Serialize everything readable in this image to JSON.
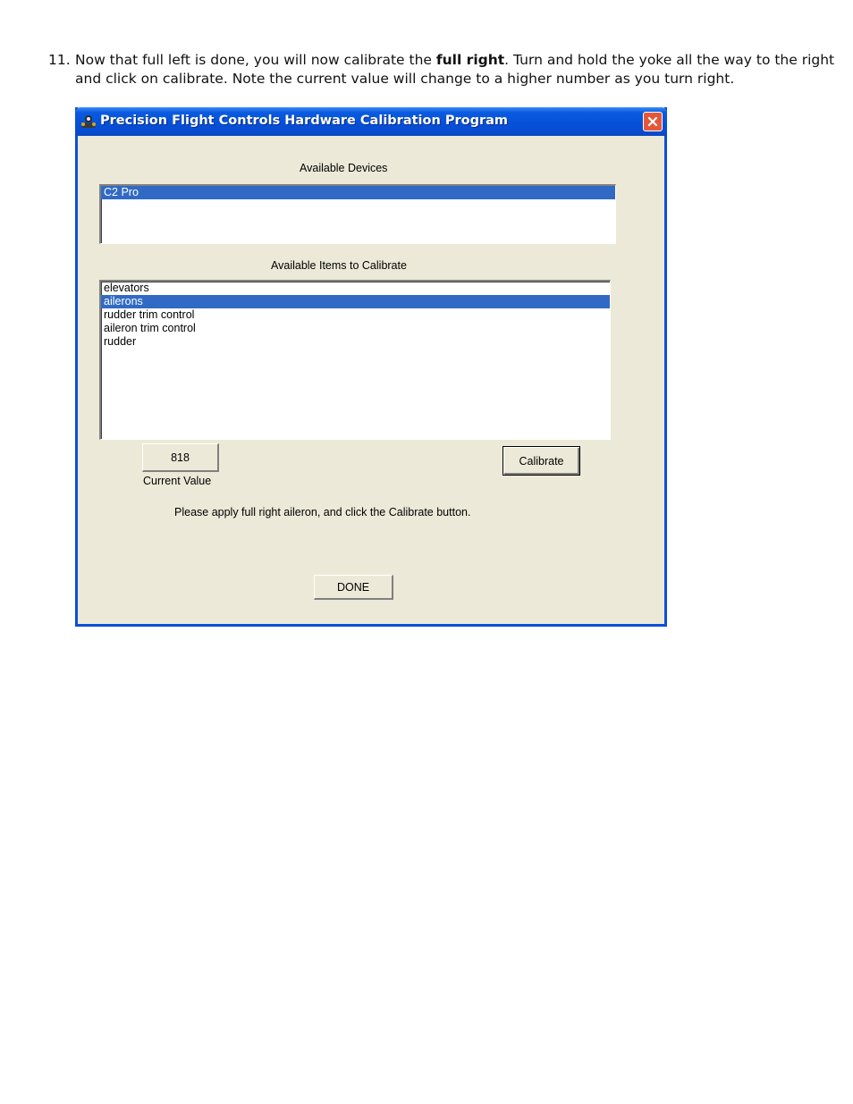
{
  "step": {
    "number": "11.",
    "text_before": "Now that full left is done, you will now calibrate the ",
    "bold": "full right",
    "text_after": ". Turn and hold the yoke all the way to the right and click on calibrate. Note the current value will change to a higher number as you turn right."
  },
  "window": {
    "title": "Precision Flight Controls Hardware Calibration Program",
    "devices_label": "Available Devices",
    "devices": [
      {
        "label": "C2 Pro",
        "selected": true
      }
    ],
    "items_label": "Available Items to Calibrate",
    "items": [
      {
        "label": "elevators",
        "selected": false
      },
      {
        "label": "ailerons",
        "selected": true
      },
      {
        "label": "rudder trim control",
        "selected": false
      },
      {
        "label": "aileron trim control",
        "selected": false
      },
      {
        "label": "rudder",
        "selected": false
      }
    ],
    "current_value": "818",
    "current_value_label": "Current Value",
    "calibrate_label": "Calibrate",
    "instruction": "Please apply full right aileron, and click the Calibrate button.",
    "done_label": "DONE"
  },
  "colors": {
    "titlebar": "#0550d8",
    "selection": "#316ac5",
    "dialog_bg": "#ece9d8",
    "close": "#e3583a"
  }
}
